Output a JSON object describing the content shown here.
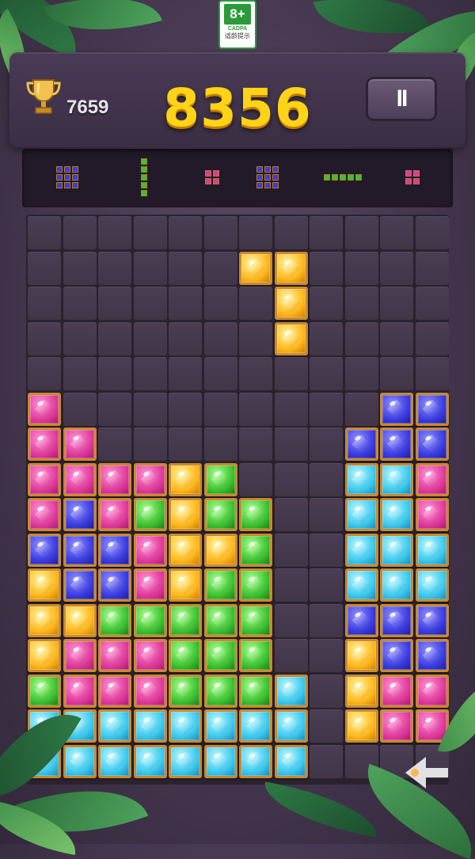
{
  "age_badge": {
    "rating": "8+",
    "org": "CADPA",
    "hint": "适龄提示"
  },
  "scores": {
    "best": "7659",
    "current": "8356"
  },
  "pause_button": {
    "label": "II"
  },
  "colors": {
    "pink": "#e03a9c",
    "blue": "#3a3ce0",
    "cyan": "#3cc9ee",
    "green": "#3cc231",
    "yellow": "#ffb81c",
    "frame": "#c98a2e"
  },
  "previews": [
    {
      "color": "blue",
      "shape": [
        [
          1,
          1,
          1
        ],
        [
          1,
          1,
          1
        ],
        [
          1,
          1,
          1
        ]
      ]
    },
    {
      "color": "green",
      "shape": [
        [
          1
        ],
        [
          1
        ],
        [
          1
        ],
        [
          1
        ],
        [
          1
        ]
      ]
    },
    {
      "color": "pink",
      "shape": [
        [
          1,
          1
        ],
        [
          1,
          1
        ]
      ]
    },
    {
      "color": "blue",
      "shape": [
        [
          1,
          1,
          1
        ],
        [
          1,
          1,
          1
        ],
        [
          1,
          1,
          1
        ]
      ]
    },
    {
      "color": "green",
      "shape": [
        [
          1,
          1,
          1,
          1,
          1
        ]
      ]
    },
    {
      "color": "pink",
      "shape": [
        [
          1,
          1
        ],
        [
          1,
          1
        ]
      ]
    }
  ],
  "board": {
    "cols": 12,
    "rows": [
      "............",
      "......YY....",
      ".......Y....",
      ".......Y....",
      "............",
      "P.........BB",
      "PP.......BBB",
      "PPPPYG...CCP",
      "PBPGYGG..CCP",
      "BBBPYYG..CCC",
      "YBBPYGG..CCC",
      "YYGGGGG..BBB",
      "YPPPGGG..YBB",
      "GPPPGGGC.YPP",
      "CCCCCCCC.YPP",
      "CCCCCCCC...."
    ]
  }
}
